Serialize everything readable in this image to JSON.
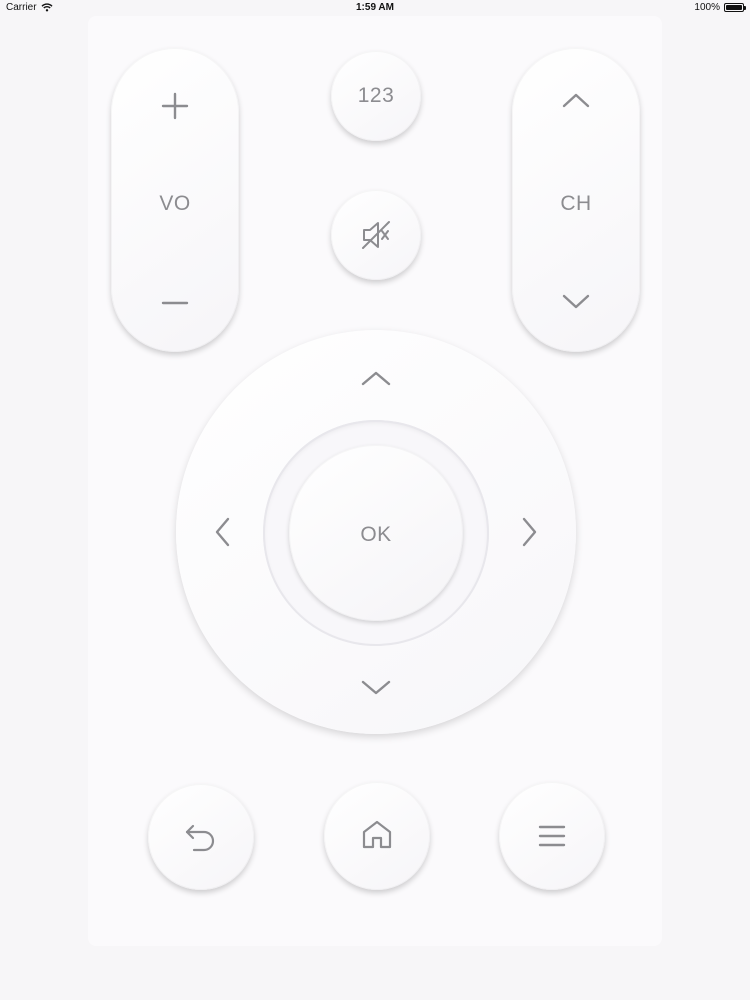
{
  "status_bar": {
    "carrier": "Carrier",
    "time": "1:59 AM",
    "battery": "100%",
    "battery_level": 1.0
  },
  "remote": {
    "volume": {
      "label": "VO",
      "up_icon": "plus-icon",
      "down_icon": "minus-icon"
    },
    "numpad": {
      "label": "123"
    },
    "mute": {
      "icon": "mute-icon"
    },
    "channel": {
      "label": "CH",
      "up_icon": "chevron-up-icon",
      "down_icon": "chevron-down-icon"
    },
    "dpad": {
      "ok_label": "OK",
      "up_icon": "chevron-up-icon",
      "down_icon": "chevron-down-icon",
      "left_icon": "chevron-left-icon",
      "right_icon": "chevron-right-icon"
    },
    "bottom": {
      "back_icon": "back-arrow-icon",
      "home_icon": "home-icon",
      "menu_icon": "menu-icon"
    }
  },
  "colors": {
    "background": "#f7f6f8",
    "button_face": "#ffffff",
    "glyph": "#8c8c90"
  }
}
